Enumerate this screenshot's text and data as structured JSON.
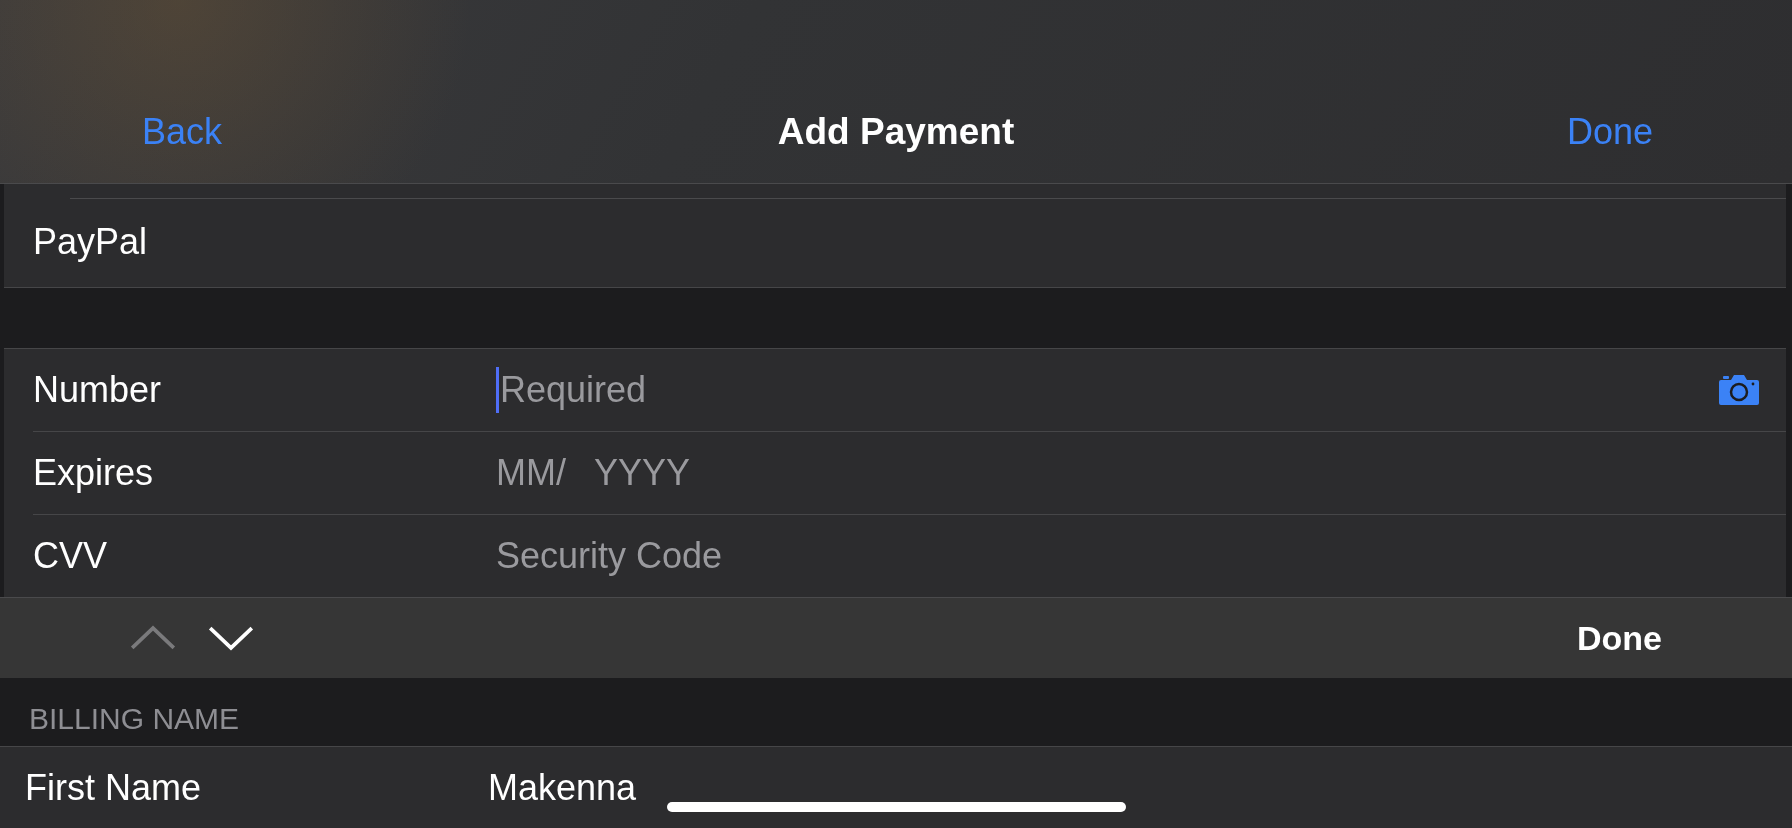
{
  "nav": {
    "back": "Back",
    "title": "Add Payment",
    "done": "Done"
  },
  "payment_method": {
    "label": "PayPal"
  },
  "card_fields": [
    {
      "kind": "text",
      "label": "Number",
      "placeholder": "Required",
      "focused": true,
      "scan_button": true
    },
    {
      "kind": "date",
      "label": "Expires",
      "month_placeholder": "MM/",
      "year_placeholder": "YYYY"
    },
    {
      "kind": "text",
      "label": "CVV",
      "placeholder": "Security Code",
      "focused": false
    }
  ],
  "keyboard_toolbar": {
    "previous": {
      "disabled": true
    },
    "next": {
      "disabled": false
    },
    "done": "Done"
  },
  "billing": {
    "header": "BILLING NAME",
    "fields": [
      {
        "kind": "text",
        "label": "First Name",
        "value": "Makenna"
      }
    ]
  }
}
